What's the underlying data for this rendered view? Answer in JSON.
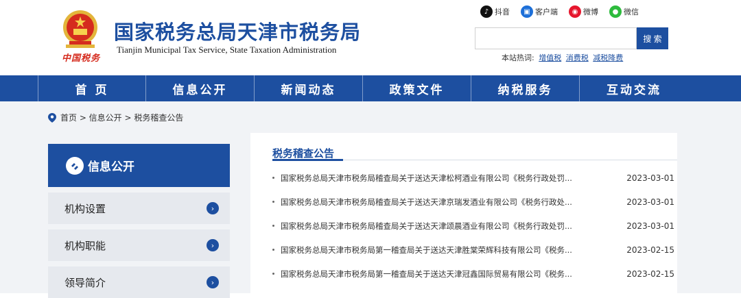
{
  "header": {
    "title": "国家税务总局天津市税务局",
    "subtitle": "Tianjin Municipal Tax Service, State Taxation Administration",
    "brand_script": "中国税务",
    "social": [
      {
        "label": "抖音",
        "icon": "douyin-icon",
        "color": "#111111"
      },
      {
        "label": "客户端",
        "icon": "client-icon",
        "color": "#1d6fd8"
      },
      {
        "label": "微博",
        "icon": "weibo-icon",
        "color": "#e6162d"
      },
      {
        "label": "微信",
        "icon": "wechat-icon",
        "color": "#2dbb3d"
      }
    ],
    "search": {
      "placeholder": "",
      "button": "搜 索"
    },
    "hotwords": {
      "label": "本站热词:",
      "items": [
        "增值税",
        "消费税",
        "减税降费"
      ]
    }
  },
  "nav": [
    "首 页",
    "信息公开",
    "新闻动态",
    "政策文件",
    "纳税服务",
    "互动交流"
  ],
  "breadcrumb": "首页 > 信息公开 > 税务稽查公告",
  "sidebar": {
    "title": "信息公开",
    "items": [
      "机构设置",
      "机构职能",
      "领导简介"
    ]
  },
  "main": {
    "section_title": "税务稽查公告",
    "rows": [
      {
        "title": "国家税务总局天津市税务局稽查局关于送达天津松柯酒业有限公司《税务行政处罚...",
        "date": "2023-03-01"
      },
      {
        "title": "国家税务总局天津市税务局稽查局关于送达天津京瑞发酒业有限公司《税务行政处...",
        "date": "2023-03-01"
      },
      {
        "title": "国家税务总局天津市税务局稽查局关于送达天津颂晨酒业有限公司《税务行政处罚...",
        "date": "2023-03-01"
      },
      {
        "title": "国家税务总局天津市税务局第一稽查局关于送达天津胜棠荣辉科技有限公司《税务...",
        "date": "2023-02-15"
      },
      {
        "title": "国家税务总局天津市税务局第一稽查局关于送达天津冠鑫国际贸易有限公司《税务...",
        "date": "2023-02-15"
      }
    ]
  },
  "colors": {
    "primary": "#1d4fa0",
    "brand_red": "#d52b1e",
    "gold": "#e3b53b"
  }
}
